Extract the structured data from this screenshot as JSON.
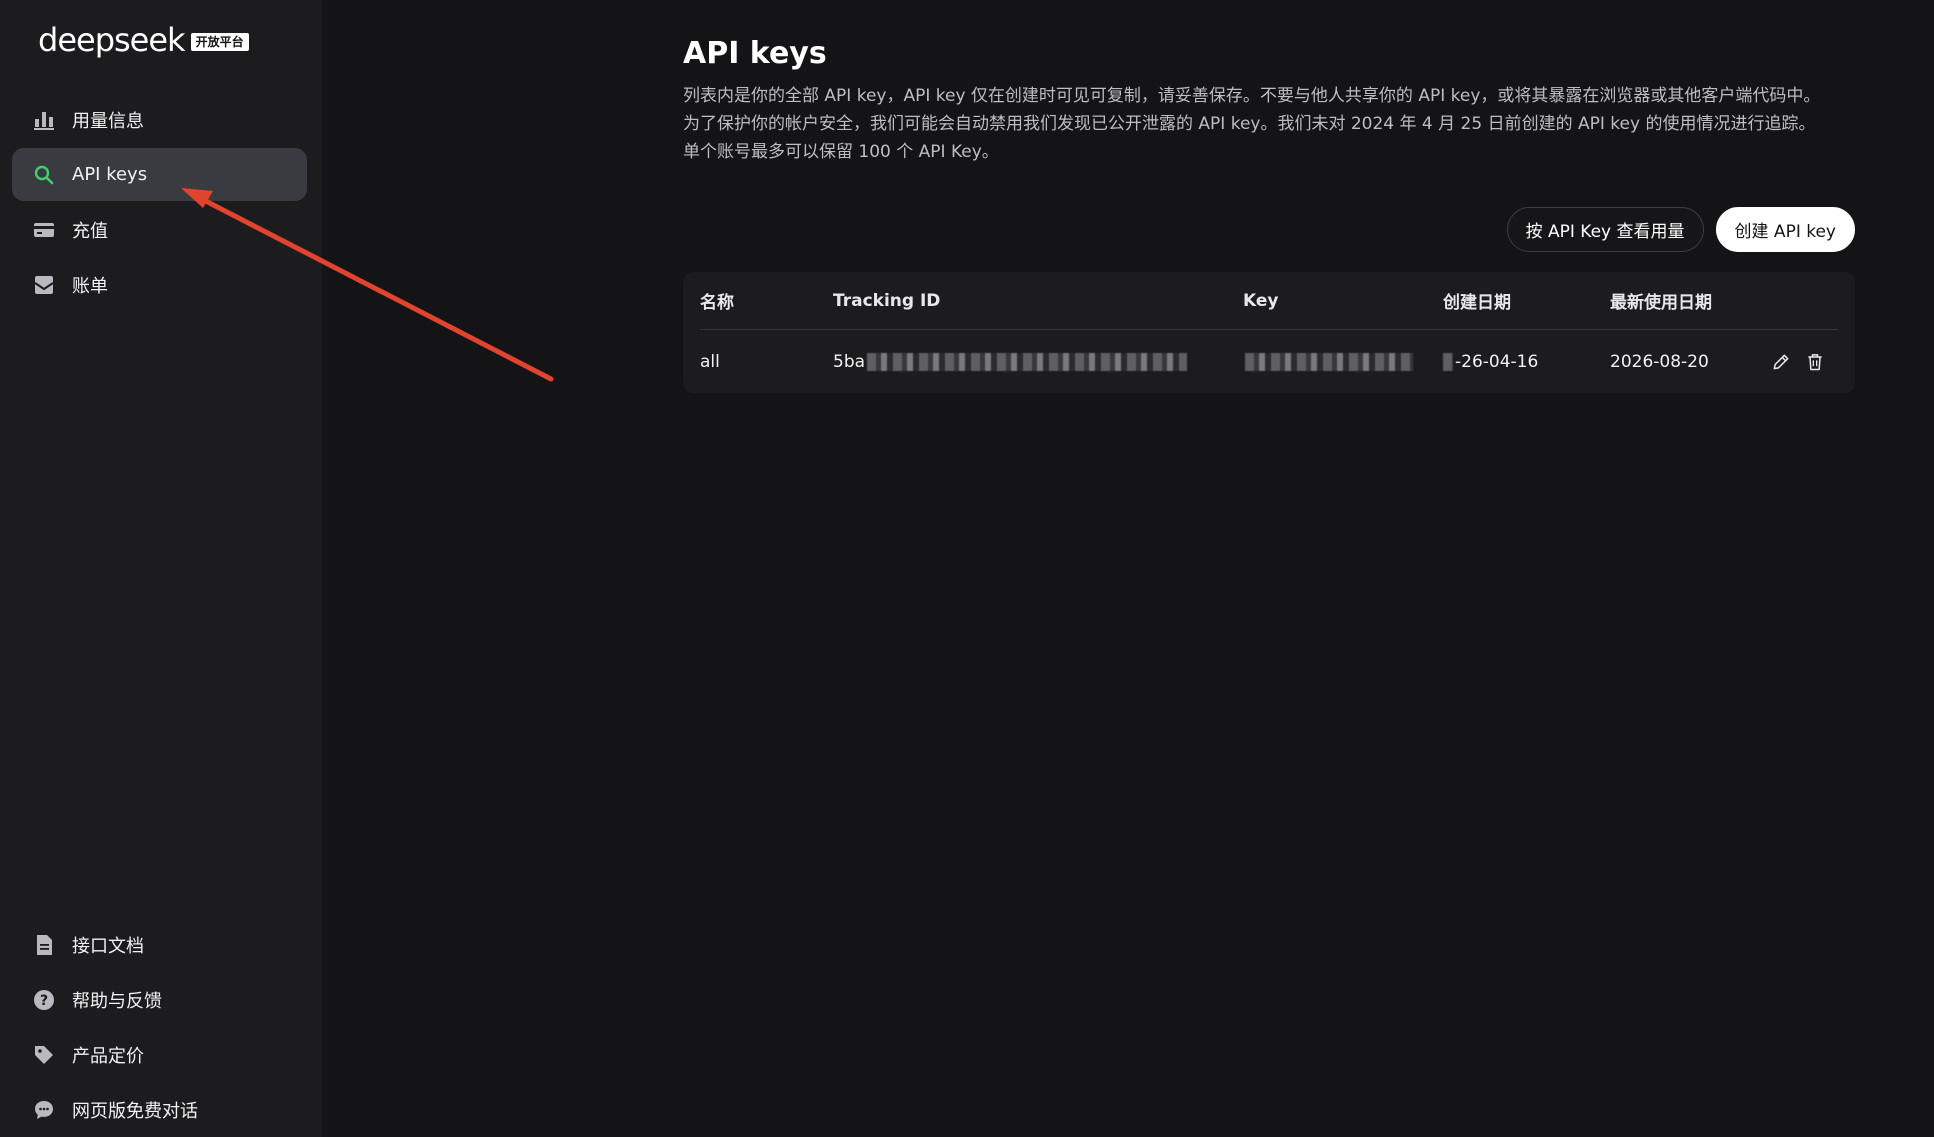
{
  "brand": {
    "name": "deepseek",
    "badge": "开放平台"
  },
  "sidebar": {
    "top_items": [
      {
        "label": "用量信息",
        "icon": "bar-chart-icon"
      },
      {
        "label": "API keys",
        "icon": "search-icon",
        "active": true
      },
      {
        "label": "充值",
        "icon": "card-icon"
      },
      {
        "label": "账单",
        "icon": "mail-icon"
      }
    ],
    "bottom_items": [
      {
        "label": "接口文档",
        "icon": "document-icon"
      },
      {
        "label": "帮助与反馈",
        "icon": "help-icon"
      },
      {
        "label": "产品定价",
        "icon": "tag-icon"
      },
      {
        "label": "网页版免费对话",
        "icon": "chat-icon"
      }
    ]
  },
  "main": {
    "title": "API keys",
    "description": "列表内是你的全部 API key，API key 仅在创建时可见可复制，请妥善保存。不要与他人共享你的 API key，或将其暴露在浏览器或其他客户端代码中。\n为了保护你的帐户安全，我们可能会自动禁用我们发现已公开泄露的 API key。我们未对 2024 年 4 月 25 日前创建的 API key 的使用情况进行追踪。\n单个账号最多可以保留 100 个 API Key。",
    "view_usage_button": "按 API Key 查看用量",
    "create_button": "创建 API key",
    "table": {
      "headers": [
        "名称",
        "Tracking ID",
        "Key",
        "创建日期",
        "最新使用日期"
      ],
      "rows": [
        {
          "name": "all",
          "tracking_id_visible": "5ba",
          "key_visible": "",
          "created_visible": "-26-04-16",
          "last_used": "2026-08-20"
        }
      ]
    }
  },
  "colors": {
    "background": "#141416",
    "sidebar": "#1c1c1f",
    "active_item": "#3a3b40",
    "accent_green": "#3fcf6b",
    "annotation_arrow": "#e0442f"
  }
}
